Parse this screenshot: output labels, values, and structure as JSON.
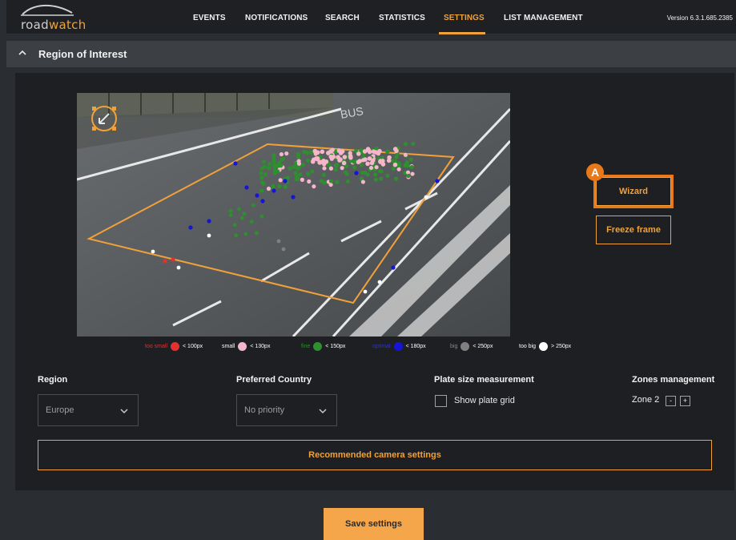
{
  "header": {
    "logo": {
      "part1": "road",
      "part2": "watch"
    },
    "nav": [
      {
        "label": "EVENTS",
        "active": false
      },
      {
        "label": "NOTIFICATIONS",
        "active": false
      },
      {
        "label": "SEARCH",
        "active": false
      },
      {
        "label": "STATISTICS",
        "active": false
      },
      {
        "label": "SETTINGS",
        "active": true
      },
      {
        "label": "LIST MANAGEMENT",
        "active": false
      }
    ],
    "version": "Version 6.3.1.685.2385"
  },
  "section": {
    "title": "Region of Interest",
    "toggle_icon": "chevron-up-icon"
  },
  "camera": {
    "actions": {
      "wizard": "Wizard",
      "freeze": "Freeze frame"
    },
    "annotation_badge": "A",
    "corner_icon": "resize-arrow-icon"
  },
  "legend": [
    {
      "name": "too small",
      "size": "< 100px",
      "color": "#e53030"
    },
    {
      "name": "small",
      "size": "< 130px",
      "color": "#f4b6c8"
    },
    {
      "name": "fine",
      "size": "< 150px",
      "color": "#2e8f2e"
    },
    {
      "name": "optimal",
      "size": "< 180px",
      "color": "#1515d6"
    },
    {
      "name": "big",
      "size": "< 250px",
      "color": "#808080"
    },
    {
      "name": "too big",
      "size": "> 250px",
      "color": "#ffffff"
    }
  ],
  "form": {
    "region": {
      "label": "Region",
      "value": "Europe"
    },
    "country": {
      "label": "Preferred Country",
      "value": "No priority"
    },
    "plate": {
      "label": "Plate size measurement",
      "checkbox_label": "Show plate grid",
      "checked": false
    },
    "zones": {
      "label": "Zones management",
      "current": "Zone 2",
      "minus": "-",
      "plus": "+"
    }
  },
  "buttons": {
    "recommended": "Recommended camera settings",
    "save": "Save settings"
  },
  "colors": {
    "accent": "#f0a13a",
    "background": "#2a2d31",
    "panel": "#1d1f22",
    "highlight": "#e8791a"
  }
}
